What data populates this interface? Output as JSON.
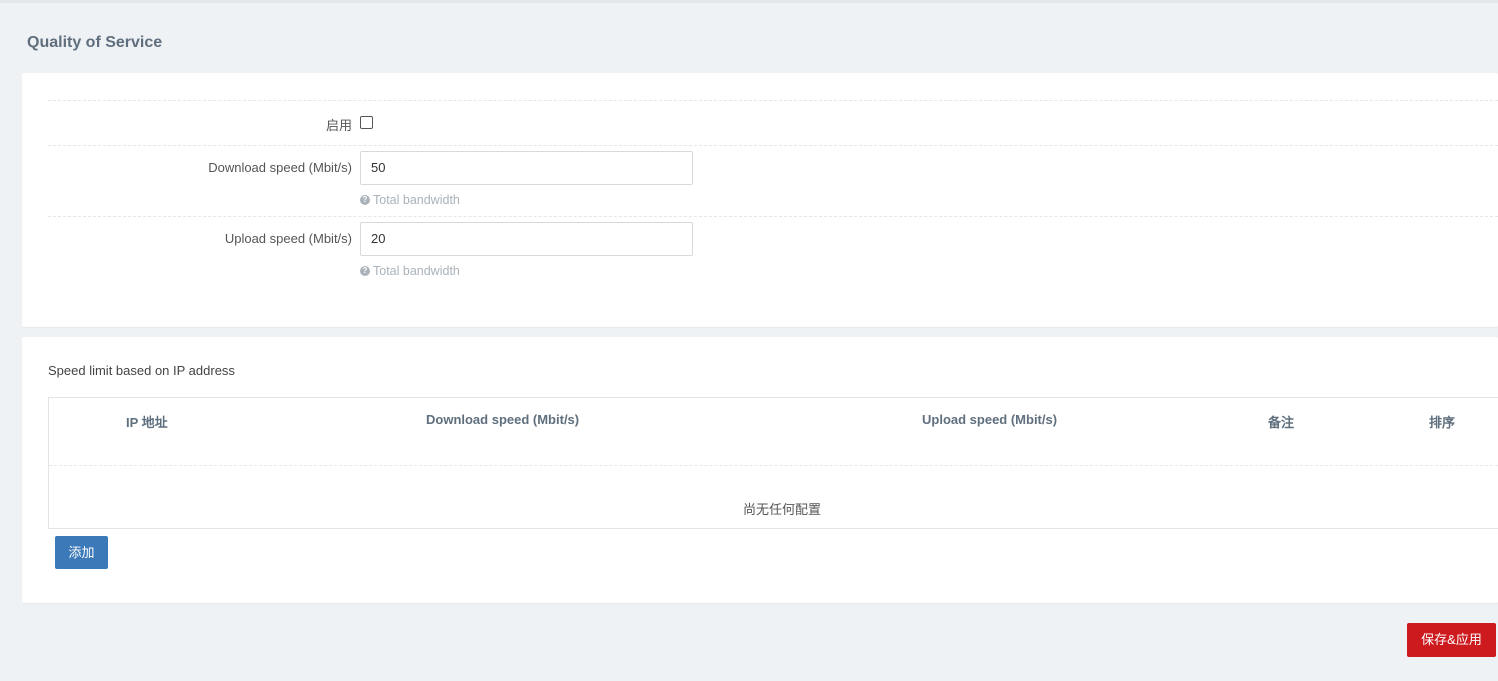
{
  "page": {
    "title": "Quality of Service"
  },
  "settings": {
    "enable_label": "启用",
    "enabled": false,
    "download": {
      "label": "Download speed (Mbit/s)",
      "value": "50",
      "help": "Total bandwidth"
    },
    "upload": {
      "label": "Upload speed (Mbit/s)",
      "value": "20",
      "help": "Total bandwidth"
    },
    "help_icon": "question-circle-icon"
  },
  "ip_limits": {
    "title": "Speed limit based on IP address",
    "columns": [
      "IP 地址",
      "Download speed (Mbit/s)",
      "Upload speed (Mbit/s)",
      "备注",
      "排序"
    ],
    "rows": [],
    "empty_text": "尚无任何配置",
    "add_label": "添加"
  },
  "footer": {
    "save_apply_label": "保存&应用"
  },
  "colors": {
    "primary": "#3b79b8",
    "danger": "#cc1a1f",
    "background": "#eff2f4"
  }
}
